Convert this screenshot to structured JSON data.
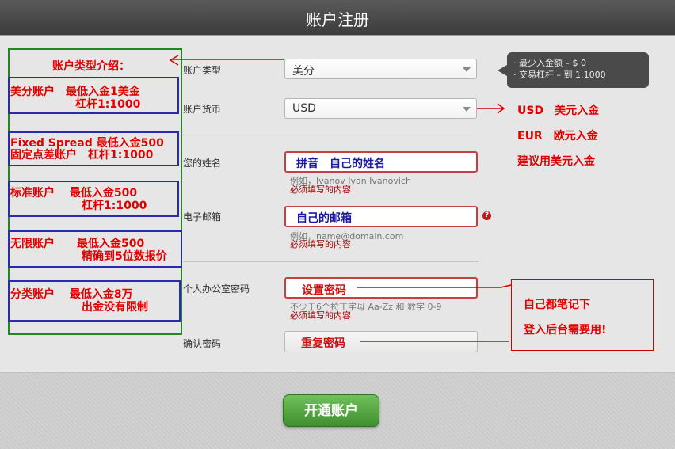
{
  "header": {
    "title": "账户注册"
  },
  "form": {
    "account_type": {
      "label": "账户类型",
      "value": "美分"
    },
    "currency": {
      "label": "账户货币",
      "value": "USD"
    },
    "name": {
      "label": "您的姓名",
      "hint": "例如，Ivanov Ivan Ivanovich",
      "required": "必须填写的内容",
      "annotation": "拼音　自己的姓名"
    },
    "email": {
      "label": "电子邮箱",
      "hint": "例如，name@domain.com",
      "required": "必须填写的内容",
      "annotation": "自己的邮箱",
      "help": "?"
    },
    "password": {
      "label": "个人办公室密码",
      "hint": "不少于6个拉丁字母 Aa-Zz 和 数字 0-9",
      "required": "必须填写的内容",
      "annotation": "设置密码"
    },
    "confirm": {
      "label": "确认密码",
      "annotation": "重复密码"
    },
    "submit_label": "开通账户"
  },
  "tooltip": {
    "line1": "· 最少入金额 – $ 0",
    "line2": "· 交易杠杆 – 到 1:1000"
  },
  "annotations": {
    "intro_title": "账户类型介绍：",
    "types": [
      {
        "line1": "美分账户　最低入金1美金",
        "line2": "杠杆1:1000"
      },
      {
        "line1": "Fixed Spread 最低入金500",
        "line2": "固定点差账户　杠杆1:1000"
      },
      {
        "line1": "标准账户　 最低入金500",
        "line2": "杠杆1:1000"
      },
      {
        "line1": "无限账户　　最低入金500",
        "line2": "精确到5位数报价"
      },
      {
        "line1": "分类账户　 最低入金8万",
        "line2": "出金没有限制"
      }
    ],
    "currency_notes": [
      "USD　美元入金",
      "EUR　欧元入金",
      "建议用美元入金"
    ],
    "password_note": [
      "自己都笔记下",
      "登入后台需要用!"
    ]
  }
}
